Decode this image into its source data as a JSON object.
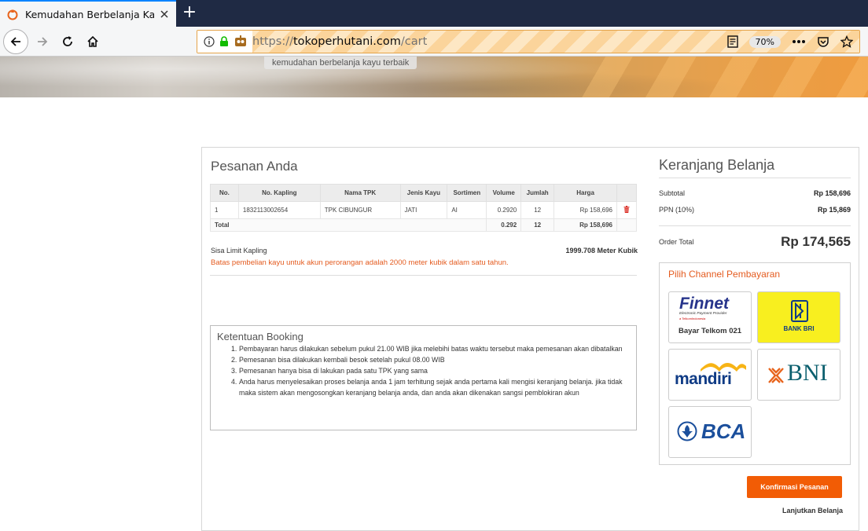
{
  "browser": {
    "tab_title": "Kemudahan Berbelanja Kayu Te",
    "new_tab_symbol": "+",
    "url_scheme": "https://",
    "url_host": "tokoperhutani.com",
    "url_path": "/cart",
    "zoom": "70%"
  },
  "banner": {
    "tagline": "kemudahan berbelanja kayu terbaik"
  },
  "orders": {
    "title": "Pesanan Anda",
    "columns": [
      "No.",
      "No. Kapling",
      "Nama TPK",
      "Jenis Kayu",
      "Sortimen",
      "Volume",
      "Jumlah",
      "Harga"
    ],
    "rows": [
      {
        "no": "1",
        "kapling": "1832113002654",
        "tpk": "TPK CIBUNGUR",
        "jenis": "JATI",
        "sortimen": "AI",
        "volume": "0.2920",
        "jumlah": "12",
        "harga": "Rp 158,696"
      }
    ],
    "total": {
      "label": "Total",
      "volume": "0.292",
      "jumlah": "12",
      "harga": "Rp 158,696"
    },
    "limit_label": "Sisa Limit Kapling",
    "limit_value": "1999.708 Meter Kubik",
    "limit_note": "Batas pembelian kayu untuk akun perorangan adalah 2000 meter kubik dalam satu tahun."
  },
  "booking": {
    "title": "Ketentuan Booking",
    "items": [
      {
        "n": "1.",
        "text": "Pembayaran harus dilakukan sebelum pukul 21.00 WIB jika melebihi batas waktu tersebut maka pemesanan akan dibatalkan"
      },
      {
        "n": "2.",
        "text": "Pemesanan bisa dilakukan kembali besok setelah pukul 08.00 WIB"
      },
      {
        "n": "3.",
        "text": "Pemesanan hanya bisa di lakukan pada satu TPK yang sama"
      },
      {
        "n": "4.",
        "text": "Anda harus menyelesaikan proses belanja anda 1 jam terhitung sejak anda pertama kali mengisi keranjang belanja. jika tidak maka sistem akan mengosongkan keranjang belanja anda, dan anda akan dikenakan sangsi pemblokiran akun"
      }
    ]
  },
  "cart": {
    "title": "Keranjang Belanja",
    "subtotal_label": "Subtotal",
    "subtotal_value": "Rp 158,696",
    "ppn_label": "PPN (10%)",
    "ppn_value": "Rp 15,869",
    "order_total_label": "Order Total",
    "order_total_value": "Rp 174,565"
  },
  "payment": {
    "title": "Pilih Channel Pembayaran",
    "finnet_logo": "Finnet",
    "finnet_tagline": "Electronic Payment Provider",
    "finnet_sub": "a TelkomIndonesia",
    "finnet_label": "Bayar Telkom 021",
    "bri_label": "BANK BRI",
    "mandiri_label": "mandiri",
    "bni_label": "BNI",
    "bca_label": "BCA"
  },
  "actions": {
    "confirm": "Konfirmasi Pesanan",
    "continue": "Lanjutkan Belanja"
  },
  "colors": {
    "accent": "#f25c05",
    "note": "#e45b1f",
    "bri_yellow": "#f8ef1f",
    "mandiri_blue": "#0f3b85",
    "bni_orange": "#e8641c",
    "bni_teal": "#0b5f6e",
    "bca_blue": "#1b4f9c"
  }
}
